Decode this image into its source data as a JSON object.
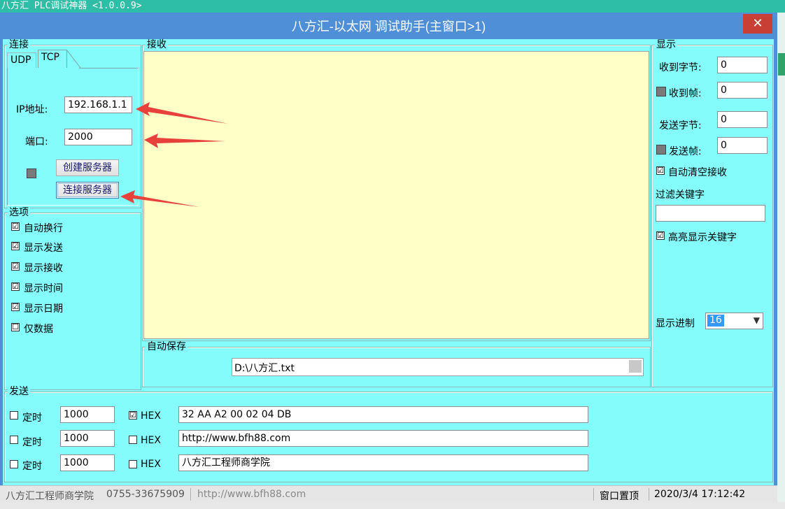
{
  "bg_title": "八方汇 PLC调试神器 <1.0.0.9>",
  "window": {
    "title": "八方汇-以太网 调试助手(主窗口>1)",
    "close": "✕"
  },
  "connect": {
    "group_title": "连接",
    "tabs": [
      "UDP",
      "TCP"
    ],
    "ip_label": "IP地址:",
    "ip_value": "192.168.1.1",
    "port_label": "端口:",
    "port_value": "2000",
    "create_server": "创建服务器",
    "connect_server": "连接服务器"
  },
  "options": {
    "group_title": "选项",
    "items": [
      {
        "label": "自动换行",
        "checked": "☑"
      },
      {
        "label": "显示发送",
        "checked": "☑"
      },
      {
        "label": "显示接收",
        "checked": "☑"
      },
      {
        "label": "显示时间",
        "checked": "☑"
      },
      {
        "label": "显示日期",
        "checked": "☑"
      },
      {
        "label": "仅数据",
        "checked": "☐"
      }
    ]
  },
  "receive": {
    "group_title": "接收"
  },
  "autosave": {
    "group_title": "自动保存",
    "path": "D:\\八方汇.txt"
  },
  "display": {
    "group_title": "显示",
    "recv_bytes_label": "收到字节:",
    "recv_bytes": "0",
    "recv_frames_label": "收到帧:",
    "recv_frames": "0",
    "send_bytes_label": "发送字节:",
    "send_bytes": "0",
    "send_frames_label": "发送帧:",
    "send_frames": "0",
    "auto_clear_label": "自动清空接收",
    "filter_label": "过滤关键字",
    "filter_value": "",
    "highlight_label": "高亮显示关键字",
    "radix_label": "显示进制",
    "radix_value": "16"
  },
  "send": {
    "group_title": "发送",
    "rows": [
      {
        "timer_label": "定时",
        "interval": "1000",
        "hex_label": "HEX",
        "hex_checked": true,
        "content": "32 AA A2 00 02 04 DB"
      },
      {
        "timer_label": "定时",
        "interval": "1000",
        "hex_label": "HEX",
        "hex_checked": false,
        "content": "http://www.bfh88.com"
      },
      {
        "timer_label": "定时",
        "interval": "1000",
        "hex_label": "HEX",
        "hex_checked": false,
        "content": "八方汇工程师商学院"
      }
    ]
  },
  "status": {
    "company": "八方汇工程师商学院",
    "phone": "0755-33675909",
    "url": "http://www.bfh88.com",
    "pin": "窗口置顶",
    "datetime": "2020/3/4 17:12:42"
  },
  "colors": {
    "client_bg": "#85fcfc",
    "titlebar": "#4f8fd8",
    "receive_bg": "#ffffc8",
    "close": "#c73f35",
    "arrow": "#e8403a"
  }
}
